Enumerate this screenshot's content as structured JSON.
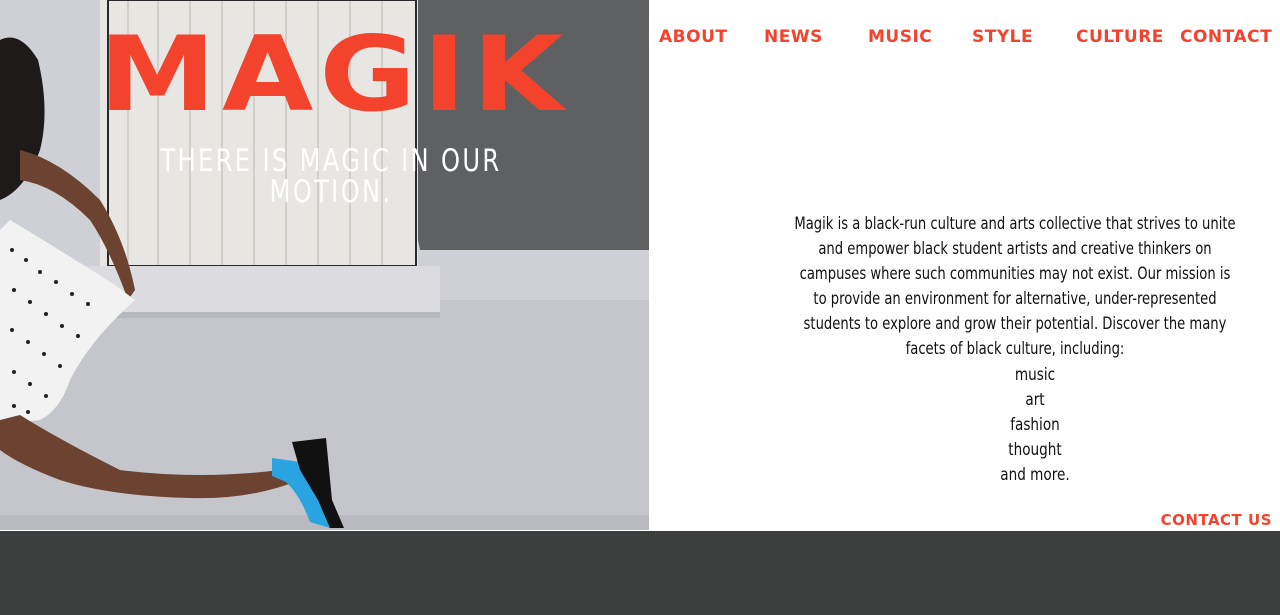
{
  "brand": {
    "title": "MAGIK",
    "tagline": "THERE IS MAGIC IN OUR MOTION."
  },
  "nav": {
    "about": "ABOUT",
    "news": "NEWS",
    "music": "MUSIC",
    "style": "STYLE",
    "culture": "CULTURE",
    "contact": "CONTACT"
  },
  "about": {
    "text": "Magik is a black-run culture and arts collective that strives to unite and empower black student artists and creative thinkers on campuses where such communities may not exist. Our mission is to provide an environment for alternative, under-represented students to explore and grow their potential. Discover the many facets of black culture, including:",
    "facets": [
      "music",
      "art",
      "fashion",
      "thought",
      "and more."
    ]
  },
  "contact_link": "CONTACT US",
  "colors": {
    "accent": "#f3432d",
    "footer": "#3d3f3f",
    "wall": "#cfcfd6"
  }
}
